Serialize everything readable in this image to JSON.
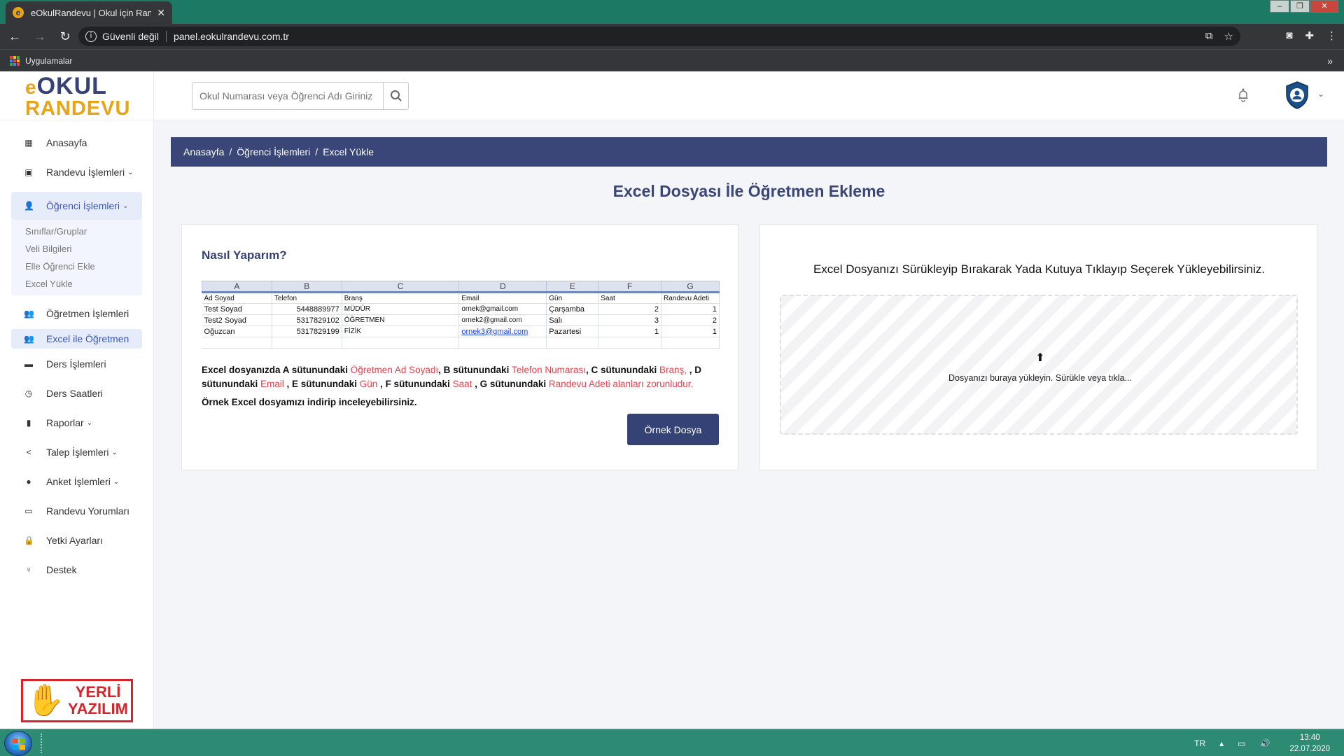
{
  "browser": {
    "tab_title": "eOkulRandevu | Okul için Randevu",
    "tab_favicon": "e",
    "security_label": "Güvenli değil",
    "url": "panel.eokulrandevu.com.tr",
    "bookmarks_apps": "Uygulamalar",
    "bookmarks_more": "»"
  },
  "logo": {
    "prefix": "e",
    "line1": "OKUL",
    "line2": "RANDEVU"
  },
  "search": {
    "placeholder": "Okul Numarası veya Öğrenci Adı Giriniz"
  },
  "sidebar": {
    "items": [
      {
        "label": "Anasayfa",
        "icon": "dashboard-icon",
        "glyph": "▦"
      },
      {
        "label": "Randevu İşlemleri",
        "icon": "calendar-icon",
        "glyph": "▣",
        "chevron": "⌄"
      },
      {
        "label": "Öğrenci İşlemleri",
        "icon": "user-icon",
        "glyph": "👤",
        "chevron": "⌄"
      },
      {
        "label": "Öğretmen İşlemleri",
        "icon": "users-icon",
        "glyph": "👥"
      },
      {
        "label": "Excel ile Öğretmen",
        "icon": "users-icon",
        "glyph": "👥"
      },
      {
        "label": "Ders İşlemleri",
        "icon": "folder-icon",
        "glyph": "▬"
      },
      {
        "label": "Ders Saatleri",
        "icon": "clock-icon",
        "glyph": "◷"
      },
      {
        "label": "Raporlar",
        "icon": "bar-chart-icon",
        "glyph": "▮",
        "chevron": "⌄"
      },
      {
        "label": "Talep İşlemleri",
        "icon": "share-icon",
        "glyph": "<",
        "chevron": "⌄"
      },
      {
        "label": "Anket İşlemleri",
        "icon": "check-circle-icon",
        "glyph": "●",
        "chevron": "⌄"
      },
      {
        "label": "Randevu Yorumları",
        "icon": "comment-icon",
        "glyph": "▭"
      },
      {
        "label": "Yetki Ayarları",
        "icon": "lock-icon",
        "glyph": "🔒"
      },
      {
        "label": "Destek",
        "icon": "support-icon",
        "glyph": "♀"
      }
    ],
    "submenu": [
      "Sınıflar/Gruplar",
      "Veli Bilgileri",
      "Elle Öğrenci Ekle",
      "Excel Yükle"
    ],
    "badge_line1": "YERLİ",
    "badge_line2": "YAZILIM"
  },
  "breadcrumb": [
    "Anasayfa",
    "Öğrenci İşlemleri",
    "Excel Yükle"
  ],
  "breadcrumb_sep": "/",
  "page_title": "Excel Dosyası İle Öğretmen Ekleme",
  "howto": {
    "title": "Nasıl Yaparım?",
    "sheet_cols": [
      "A",
      "B",
      "C",
      "D",
      "E",
      "F",
      "G"
    ],
    "sheet_header": [
      "Ad Soyad",
      "Telefon",
      "Branş",
      "Email",
      "Gün",
      "Saat",
      "Randevu Adeti"
    ],
    "sheet_rows": [
      [
        "Test Soyad",
        "5448889977",
        "MÜDÜR",
        "ornek@gmail.com",
        "Çarşamba",
        "2",
        "1"
      ],
      [
        "Test2 Soyad",
        "5317829102",
        "ÖĞRETMEN",
        "ornek2@gmail.com",
        "Salı",
        "3",
        "2"
      ],
      [
        "Oğuzcan",
        "5317829199",
        "FİZİK",
        "ornek3@gmail.com",
        "Pazartesi",
        "1",
        "1"
      ]
    ],
    "desc": {
      "t1": "Excel dosyanızda A sütunundaki ",
      "r1": "Öğretmen Ad Soyadı",
      "t2": ", B sütunundaki ",
      "r2": "Telefon Numarası",
      "t3": ", C sütunundaki ",
      "r3": "Branş, ",
      "t4": ", D sütunundaki ",
      "r4": "Email ",
      "t5": ", E sütunundaki ",
      "r5": "Gün ",
      "t6": ", F sütunundaki ",
      "r6": "Saat ",
      "t7": ", G sütunundaki ",
      "r7": "Randevu Adeti alanları zorunludur."
    },
    "download_text": "Örnek Excel dosyamızı indirip inceleyebilirsiniz.",
    "button": "Örnek Dosya"
  },
  "upload": {
    "title": "Excel Dosyanızı Sürükleyip Bırakarak Yada Kutuya Tıklayıp Seçerek Yükleyebilirsiniz.",
    "icon": "⬆",
    "drop_text": "Dosyanızı buraya yükleyin. Sürükle veya tıkla..."
  },
  "taskbar": {
    "lang": "TR",
    "time": "13:40",
    "date": "22.07.2020"
  },
  "colors": {
    "primary": "#344275",
    "accent": "#e8a317",
    "required_red": "#e8414d",
    "active_bg": "#e7ecfb"
  }
}
